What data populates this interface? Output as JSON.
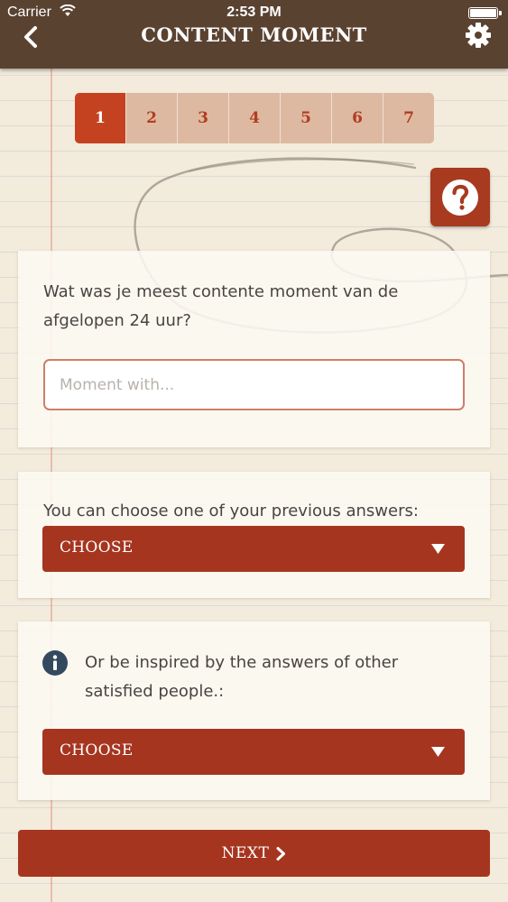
{
  "status_bar": {
    "carrier": "Carrier",
    "time": "2:53 PM"
  },
  "nav": {
    "title": "CONTENT MOMENT",
    "back_icon": "chevron-left-icon",
    "settings_icon": "gear-icon"
  },
  "stepper": {
    "steps": [
      "1",
      "2",
      "3",
      "4",
      "5",
      "6",
      "7"
    ],
    "active": "1"
  },
  "help": {
    "icon": "question-mark-icon"
  },
  "question": {
    "text": "Wat was je meest contente moment van de afgelopen 24 uur?",
    "input_placeholder": "Moment with...",
    "input_value": ""
  },
  "previous": {
    "label": "You can choose one of your previous answers:",
    "dropdown_value": "CHOOSE"
  },
  "inspire": {
    "icon": "info-icon",
    "label": "Or be inspired by the answers of other satisfied people.:",
    "dropdown_value": "CHOOSE"
  },
  "footer": {
    "next_label": "NEXT"
  },
  "colors": {
    "nav_bar": "#5a4231",
    "accent": "#a63520",
    "active_step": "#c54221",
    "inactive_step": "#ddb9a1",
    "paper": "#f3ebdc"
  }
}
